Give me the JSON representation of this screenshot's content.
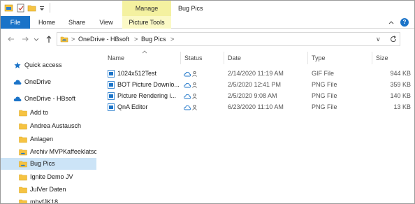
{
  "title_bar": {
    "manage_label": "Manage",
    "window_title": "Bug Pics"
  },
  "ribbon": {
    "tabs": [
      "File",
      "Home",
      "Share",
      "View",
      "Picture Tools"
    ],
    "help": "?"
  },
  "address": {
    "segments": [
      "OneDrive - HBsoft",
      "Bug Pics"
    ],
    "separators": [
      ">",
      ">",
      ">"
    ],
    "dropdown": "∨"
  },
  "sidebar": {
    "items": [
      {
        "label": "Quick access",
        "icon": "star-icon"
      },
      {
        "label": "OneDrive",
        "icon": "cloud-icon"
      },
      {
        "label": "OneDrive - HBsoft",
        "icon": "cloud-icon"
      },
      {
        "label": "Add to",
        "icon": "folder-icon"
      },
      {
        "label": "Andrea Austausch",
        "icon": "folder-icon"
      },
      {
        "label": "Anlagen",
        "icon": "folder-icon"
      },
      {
        "label": "Archiv MVPKaffeeklatsc",
        "icon": "shared-folder-icon"
      },
      {
        "label": "Bug Pics",
        "icon": "shared-folder-icon",
        "selected": true
      },
      {
        "label": "Ignite Demo JV",
        "icon": "folder-icon"
      },
      {
        "label": "JulVer Daten",
        "icon": "folder-icon"
      },
      {
        "label": "mbyfJK18",
        "icon": "folder-icon"
      }
    ]
  },
  "file_list": {
    "columns": [
      "Name",
      "Status",
      "Date",
      "Type",
      "Size"
    ],
    "rows": [
      {
        "name": "1024x512Test",
        "date": "2/14/2020 11:19 AM",
        "type": "GIF File",
        "size": "944 KB"
      },
      {
        "name": "BOT Picture Downlo...",
        "date": "2/5/2020 12:41 PM",
        "type": "PNG File",
        "size": "359 KB"
      },
      {
        "name": "Picture Rendering i...",
        "date": "2/5/2020 9:08 AM",
        "type": "PNG File",
        "size": "140 KB"
      },
      {
        "name": "QnA Editor",
        "date": "6/23/2020 11:10 AM",
        "type": "PNG File",
        "size": "13 KB"
      }
    ]
  },
  "colors": {
    "file_tab": "#1a73c8",
    "manage_context": "#f4f1a0",
    "selection": "#cce4f7",
    "folder": "#f6c342",
    "cloud": "#1a73c8"
  }
}
